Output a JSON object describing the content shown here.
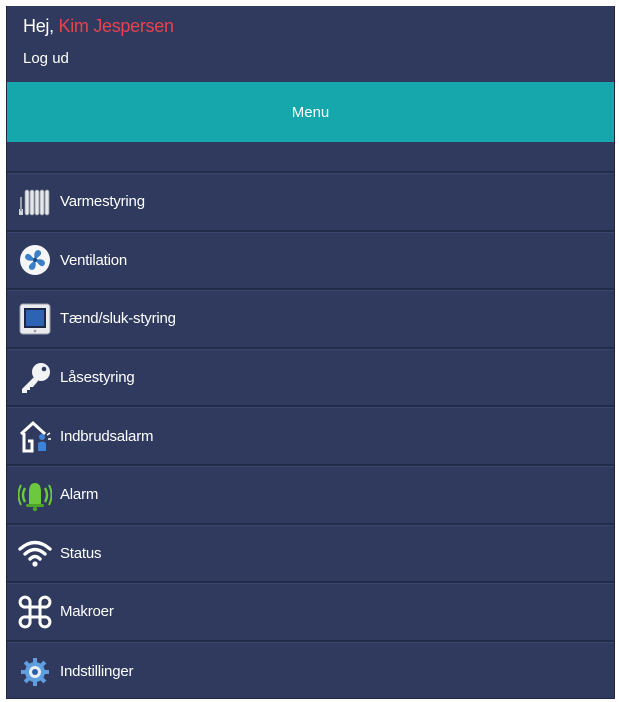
{
  "header": {
    "greeting": "Hej,",
    "user_name": "Kim Jespersen",
    "logout_label": "Log ud"
  },
  "menu": {
    "label": "Menu",
    "items": [
      {
        "label": "Varmestyring",
        "icon": "radiator-icon"
      },
      {
        "label": "Ventilation",
        "icon": "fan-icon"
      },
      {
        "label": "Tænd/sluk-styring",
        "icon": "tablet-icon"
      },
      {
        "label": "Låsestyring",
        "icon": "key-icon"
      },
      {
        "label": "Indbrudsalarm",
        "icon": "intruder-house-icon"
      },
      {
        "label": "Alarm",
        "icon": "bell-icon"
      },
      {
        "label": "Status",
        "icon": "wifi-icon"
      },
      {
        "label": "Makroer",
        "icon": "command-icon"
      },
      {
        "label": "Indstillinger",
        "icon": "gear-icon"
      }
    ]
  },
  "colors": {
    "background": "#2f3a5e",
    "menu_bar": "#16a7ad",
    "user_name": "#e8424f"
  }
}
